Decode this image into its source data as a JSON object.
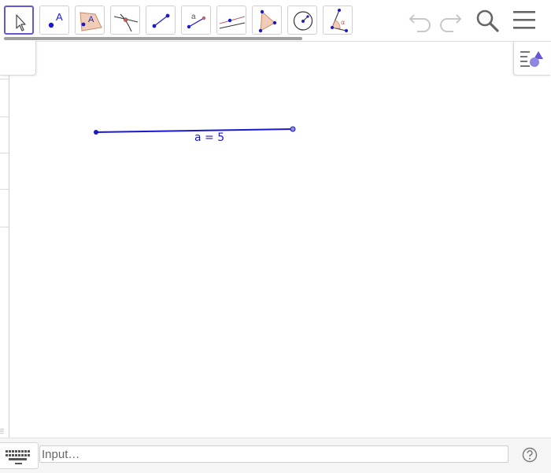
{
  "toolbar": {
    "tools": [
      {
        "id": "move",
        "icon": "arrow-pointer-icon",
        "active": true
      },
      {
        "id": "point",
        "icon": "point-icon",
        "label": "A"
      },
      {
        "id": "polygon-region",
        "icon": "polygon-icon",
        "label": "A"
      },
      {
        "id": "intersect",
        "icon": "intersect-icon"
      },
      {
        "id": "segment",
        "icon": "segment-icon"
      },
      {
        "id": "segment-fixed-length",
        "icon": "segment-length-icon",
        "label": "a"
      },
      {
        "id": "line",
        "icon": "line-icon"
      },
      {
        "id": "polygon",
        "icon": "triangle-icon"
      },
      {
        "id": "circle",
        "icon": "circle-icon"
      },
      {
        "id": "angle",
        "icon": "angle-icon",
        "label": "α"
      }
    ],
    "undo_icon": "undo-icon",
    "redo_icon": "redo-icon",
    "search_icon": "search-icon",
    "menu_icon": "hamburger-menu-icon"
  },
  "graphics": {
    "segment_label": "a = 5",
    "corner_marker": "⁞⁞"
  },
  "input_bar": {
    "placeholder": "Input…",
    "value": "",
    "keyboard_icon": "keyboard-icon",
    "help_icon": "help-icon"
  },
  "colors": {
    "accent": "#6557d2",
    "object_blue": "#1a1acc",
    "polygon_fill": "#f1cdb8",
    "toolbar_icon_gray": "#8a8a8a"
  }
}
